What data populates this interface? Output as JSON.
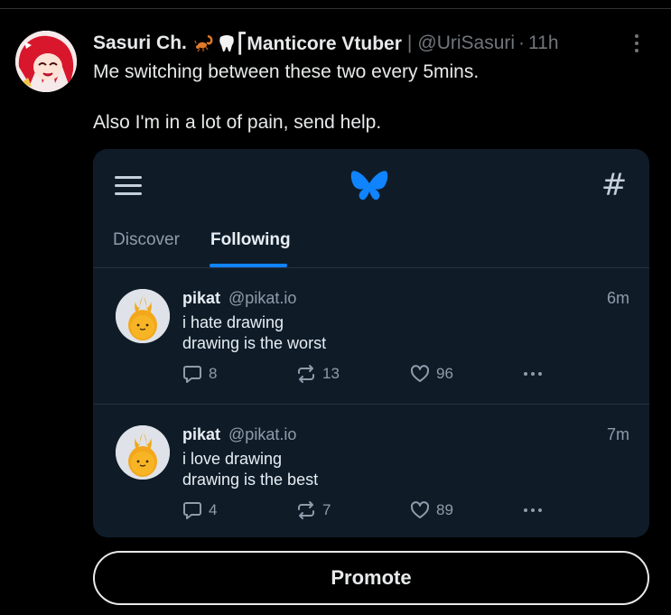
{
  "tweet": {
    "display_name": "Sasuri Ch.",
    "name_suffix": "⎡Manticore Vtuber",
    "separator": "|",
    "handle": "@UriSasuri",
    "dot": "·",
    "time": "11h",
    "text_lines": [
      "Me switching between these two every 5mins.",
      "Also I'm in a lot of pain, send help."
    ]
  },
  "embedded": {
    "tabs": [
      {
        "label": "Discover",
        "active": false
      },
      {
        "label": "Following",
        "active": true
      }
    ],
    "hash_symbol": "#",
    "accent_color": "#1083fe",
    "posts": [
      {
        "name": "pikat",
        "handle": "@pikat.io",
        "time": "6m",
        "lines": [
          "i hate drawing",
          "drawing is the worst"
        ],
        "replies": "8",
        "reposts": "13",
        "likes": "96"
      },
      {
        "name": "pikat",
        "handle": "@pikat.io",
        "time": "7m",
        "lines": [
          "i love drawing",
          "drawing is the best"
        ],
        "replies": "4",
        "reposts": "7",
        "likes": "89"
      }
    ]
  },
  "promote_label": "Promote",
  "icons": [
    "scorpion-emoji-icon",
    "tooth-emoji-icon",
    "more-options-icon",
    "menu-icon",
    "butterfly-logo-icon",
    "hashtag-icon",
    "reply-icon",
    "repost-icon",
    "like-icon",
    "post-more-icon"
  ]
}
